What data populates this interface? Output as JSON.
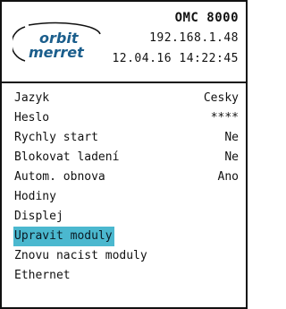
{
  "header": {
    "logo_line1": "orbit",
    "logo_line2": "merret",
    "title": "OMC 8000",
    "ip": "192.168.1.48",
    "datetime": "12.04.16 14:22:45"
  },
  "menu": {
    "selected_index": 7,
    "items": [
      {
        "label": "Jazyk",
        "value": "Cesky"
      },
      {
        "label": "Heslo",
        "value": "****"
      },
      {
        "label": "Rychly start",
        "value": "Ne"
      },
      {
        "label": "Blokovat ladení",
        "value": "Ne"
      },
      {
        "label": "Autom. obnova",
        "value": "Ano"
      },
      {
        "label": "Hodiny",
        "value": ""
      },
      {
        "label": "Displej",
        "value": ""
      },
      {
        "label": "Upravit moduly",
        "value": ""
      },
      {
        "label": "Znovu nacist moduly",
        "value": ""
      },
      {
        "label": "Ethernet",
        "value": ""
      }
    ]
  },
  "colors": {
    "selection": "#4bb8cf",
    "logo": "#1b5e8c"
  }
}
